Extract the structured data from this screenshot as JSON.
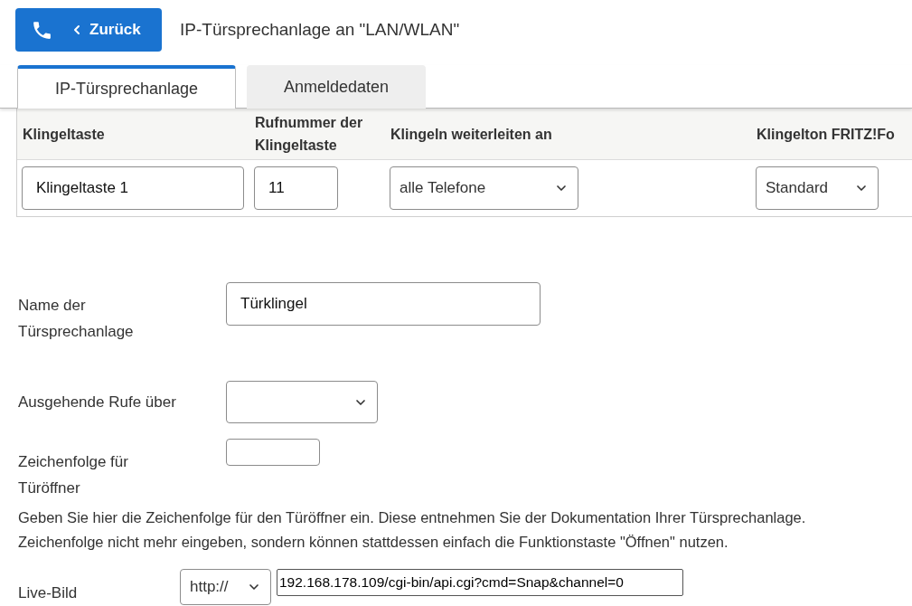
{
  "header": {
    "back_button": {
      "label": "Zurück"
    },
    "title": "IP-Türsprechanlage an \"LAN/WLAN\""
  },
  "tabs": [
    {
      "label": "IP-Türsprechanlage",
      "selected": true
    },
    {
      "label": "Anmeldedaten",
      "selected": false
    }
  ],
  "table": {
    "columns": [
      "Klingeltaste",
      "Rufnummer der Klingeltaste",
      "Klingeln weiterleiten an",
      "Klingelton FRITZ!Fo"
    ],
    "rows": [
      {
        "cells": [
          {
            "kind": "input",
            "value": "Klingeltaste 1"
          },
          {
            "kind": "input",
            "value": "11"
          },
          {
            "kind": "select",
            "value": "alle Telefone"
          },
          {
            "kind": "select",
            "value": "Standard"
          }
        ]
      }
    ]
  },
  "form": {
    "fields": [
      {
        "label": "Name der Türsprechanlage",
        "kind": "input",
        "value": "Türklingel"
      },
      {
        "label": "Ausgehende Rufe über",
        "kind": "select"
      },
      {
        "label": "Zeichenfolge für Türöffner",
        "kind": "input"
      }
    ],
    "hint_lines": [
      "Geben Sie hier die Zeichenfolge für den Türöffner ein. Diese entnehmen Sie der Dokumentation Ihrer Türsprechanlage.",
      "Zeichenfolge nicht mehr eingeben, sondern können stattdessen einfach die Funktionstaste \"Öffnen\" nutzen."
    ],
    "live_image": {
      "label": "Live-Bild",
      "protocol": "http://",
      "url": "192.168.178.109/cgi-bin/api.cgi?cmd=Snap&channel=0"
    }
  }
}
